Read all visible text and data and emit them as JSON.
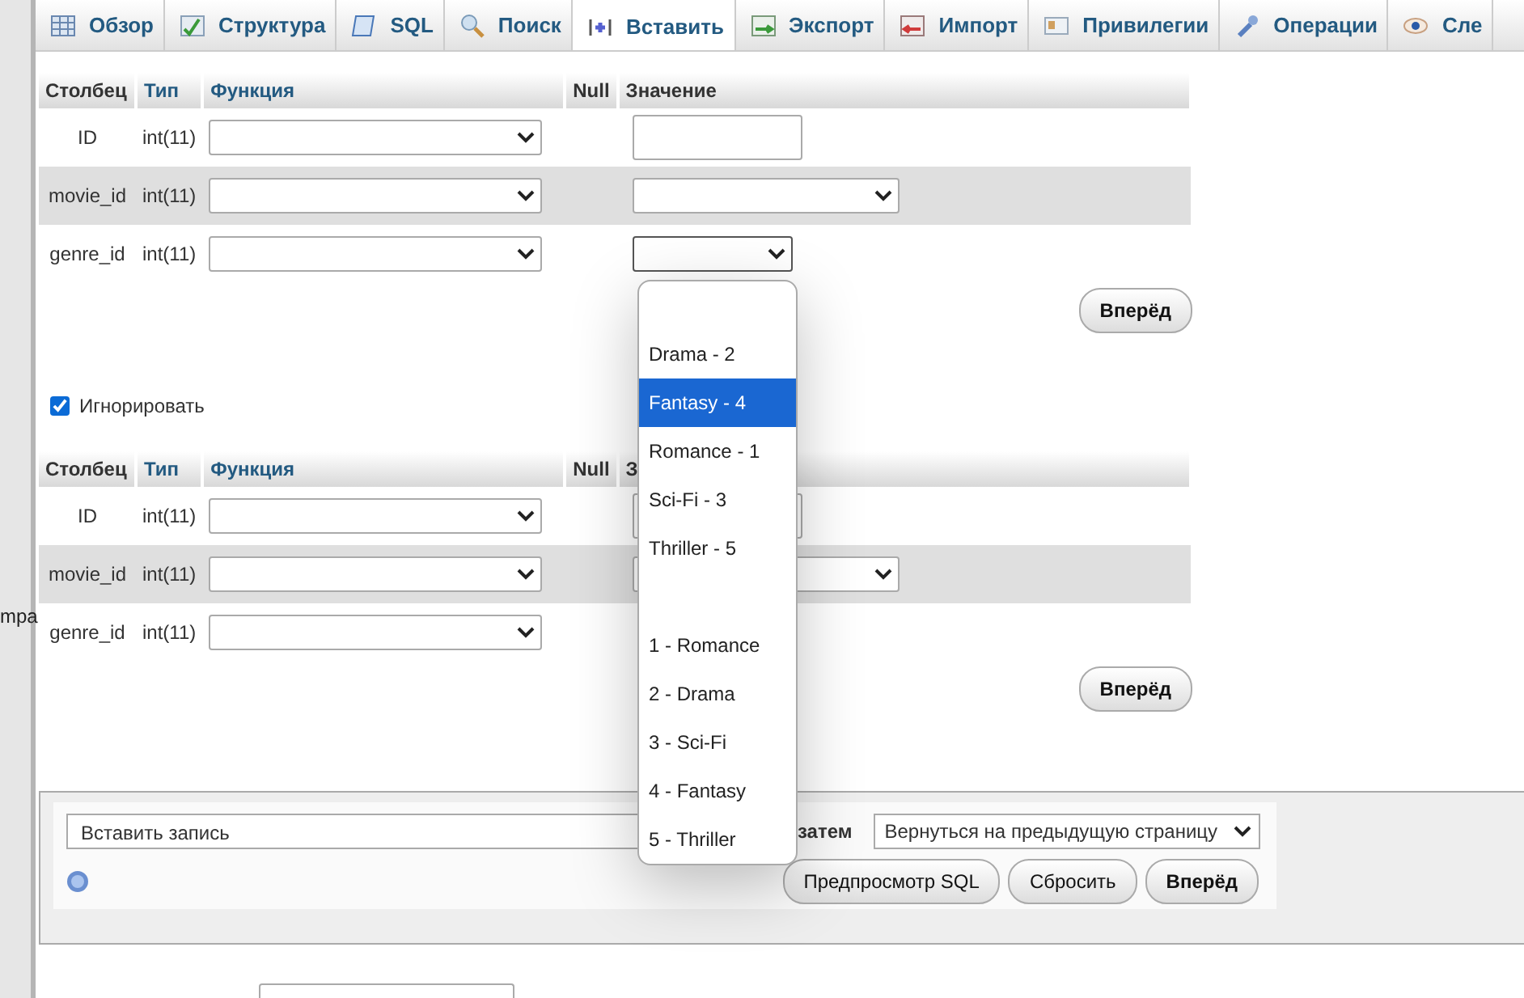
{
  "left_panel": {
    "cut_text": "mpa"
  },
  "tabs": [
    {
      "label": "Обзор",
      "selected": false
    },
    {
      "label": "Структура",
      "selected": false
    },
    {
      "label": "SQL",
      "selected": false
    },
    {
      "label": "Поиск",
      "selected": false
    },
    {
      "label": "Вставить",
      "selected": true
    },
    {
      "label": "Экспорт",
      "selected": false
    },
    {
      "label": "Импорт",
      "selected": false
    },
    {
      "label": "Привилегии",
      "selected": false
    },
    {
      "label": "Операции",
      "selected": false
    },
    {
      "label": "Сле",
      "selected": false
    }
  ],
  "insert_forms": [
    {
      "headers": [
        {
          "text": "Столбец",
          "link": false
        },
        {
          "text": "Тип",
          "link": true
        },
        {
          "text": "Функция",
          "link": true
        },
        {
          "text": "Null",
          "link": false
        },
        {
          "text": "Значение",
          "link": false
        }
      ],
      "rows": [
        {
          "column": "ID",
          "type": "int(11)",
          "kind": "input"
        },
        {
          "column": "movie_id",
          "type": "int(11)",
          "kind": "select"
        },
        {
          "column": "genre_id",
          "type": "int(11)",
          "kind": "open"
        }
      ],
      "submit": "Вперёд"
    },
    {
      "headers": [
        {
          "text": "Столбец",
          "link": false
        },
        {
          "text": "Тип",
          "link": true
        },
        {
          "text": "Функция",
          "link": true
        },
        {
          "text": "Null",
          "link": false
        },
        {
          "text": "З",
          "link": false
        }
      ],
      "rows": [
        {
          "column": "ID",
          "type": "int(11)",
          "kind": "input"
        },
        {
          "column": "movie_id",
          "type": "int(11)",
          "kind": "select"
        },
        {
          "column": "genre_id",
          "type": "int(11)",
          "kind": "plain"
        }
      ],
      "submit": "Вперёд"
    }
  ],
  "ignore": {
    "label": "Игнорировать",
    "checked": true
  },
  "dropdown": {
    "options": [
      {
        "kind": "blank"
      },
      {
        "text": "Drama - 2",
        "selected": false
      },
      {
        "text": "Fantasy - 4",
        "selected": true
      },
      {
        "text": "Romance - 1",
        "selected": false
      },
      {
        "text": "Sci-Fi - 3",
        "selected": false
      },
      {
        "text": "Thriller - 5",
        "selected": false
      },
      {
        "kind": "blank"
      },
      {
        "text": "1 - Romance",
        "selected": false
      },
      {
        "text": "2 - Drama",
        "selected": false
      },
      {
        "text": "3 - Sci-Fi",
        "selected": false
      },
      {
        "text": "4 - Fantasy",
        "selected": false
      },
      {
        "text": "5 - Thriller",
        "selected": false
      }
    ]
  },
  "footer": {
    "action": "Вставить запись",
    "then_label": "затем",
    "after": "Вернуться на предыдущую страницу",
    "buttons": [
      {
        "label": "Предпросмотр SQL",
        "bold": false
      },
      {
        "label": "Сбросить",
        "bold": false
      },
      {
        "label": "Вперёд",
        "bold": true
      }
    ]
  }
}
